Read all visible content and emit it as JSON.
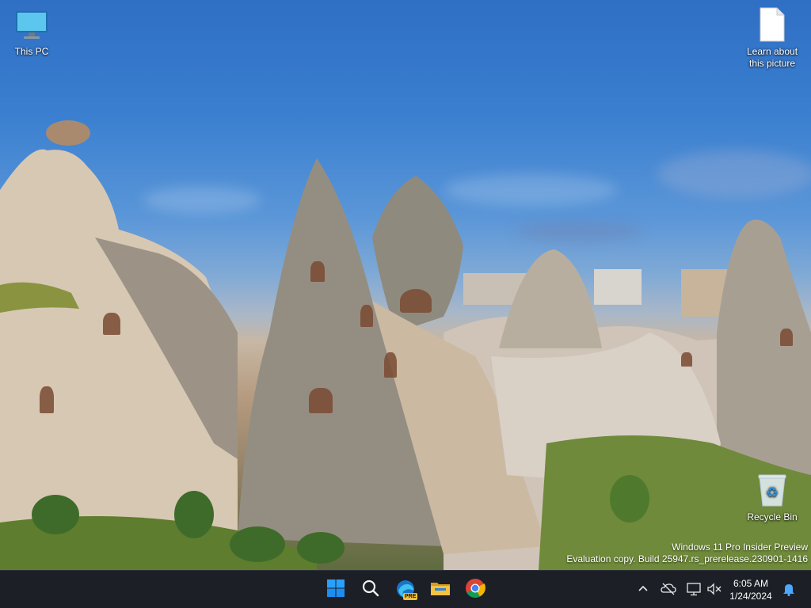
{
  "desktop": {
    "icons": {
      "this_pc": {
        "label": "This PC",
        "icon": "monitor-icon"
      },
      "learn_picture": {
        "label_line1": "Learn about",
        "label_line2": "this picture",
        "icon": "document-icon"
      },
      "recycle_bin": {
        "label": "Recycle Bin",
        "icon": "recycle-bin-icon"
      }
    },
    "watermark": {
      "line1": "Windows 11 Pro Insider Preview",
      "line2": "Evaluation copy. Build 25947.rs_prerelease.230901-1416"
    }
  },
  "taskbar": {
    "pinned": [
      {
        "name": "start",
        "icon": "windows-logo-icon",
        "color": "#1e90ff"
      },
      {
        "name": "search",
        "icon": "search-icon"
      },
      {
        "name": "edge-preview",
        "icon": "edge-pre-icon",
        "badge": "PRE"
      },
      {
        "name": "file-explorer",
        "icon": "folder-icon",
        "color": "#f2c037"
      },
      {
        "name": "chrome",
        "icon": "chrome-icon"
      }
    ],
    "tray": {
      "overflow_icon": "chevron-up-icon",
      "cloud_icon": "onedrive-offline-icon",
      "network_icon": "network-icon",
      "volume_icon": "volume-muted-icon",
      "notification_icon": "bell-icon",
      "accent": "#4aa8ff"
    },
    "clock": {
      "time": "6:05 AM",
      "date": "1/24/2024"
    }
  }
}
